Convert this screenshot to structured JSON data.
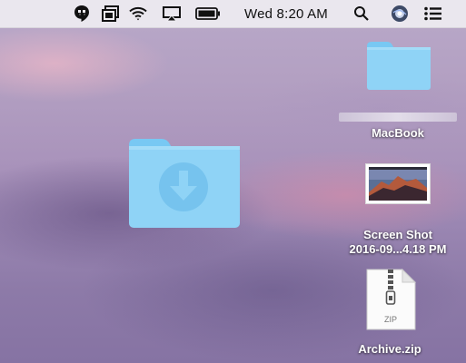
{
  "menubar": {
    "clock": "Wed 8:20 AM",
    "icons": [
      "hangouts-icon",
      "sync-icon",
      "wifi-icon",
      "airplay-icon",
      "battery-icon",
      "spotlight-search-icon",
      "siri-icon",
      "notification-center-icon"
    ]
  },
  "desktop": {
    "downloads_folder_icon": "downloads-folder-icon",
    "items": [
      {
        "icon": "folder-icon",
        "label": "MacBook"
      },
      {
        "icon": "screenshot-thumbnail-icon",
        "label_line1": "Screen Shot",
        "label_line2": "2016-09...4.18 PM"
      },
      {
        "icon": "zip-file-icon",
        "label": "Archive.zip",
        "badge": "ZIP"
      }
    ]
  },
  "colors": {
    "folder_light": "#8fd3f6",
    "folder_dark": "#6cc0ef",
    "menubar_bg": "#eeecf1",
    "wallpaper_purple": "#9a86b2"
  }
}
